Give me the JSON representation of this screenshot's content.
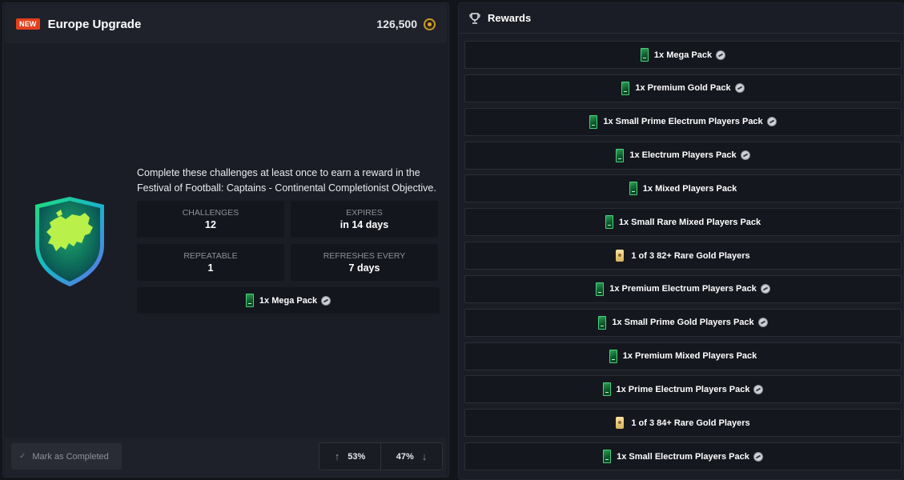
{
  "header": {
    "badge": "NEW",
    "title": "Europe Upgrade",
    "price": "126,500"
  },
  "description": "Complete these challenges at least once to earn a reward in the Festival of Football: Captains - Continental Completionist Objective.",
  "stats": {
    "challenges": {
      "label": "CHALLENGES",
      "value": "12"
    },
    "expires": {
      "label": "EXPIRES",
      "value": "in 14 days"
    },
    "repeatable": {
      "label": "REPEATABLE",
      "value": "1"
    },
    "refreshes": {
      "label": "REFRESHES EVERY",
      "value": "7 days"
    }
  },
  "main_reward": {
    "label": "1x Mega Pack",
    "icon": "pack-icon",
    "untradeable": true
  },
  "footer": {
    "mark_completed": "Mark as Completed",
    "upvote_percent": "53%",
    "downvote_percent": "47%"
  },
  "rewards_panel": {
    "title": "Rewards",
    "items": [
      {
        "label": "1x Mega Pack",
        "icon": "pack-icon",
        "untradeable": true
      },
      {
        "label": "1x Premium Gold Pack",
        "icon": "pack-icon",
        "untradeable": true
      },
      {
        "label": "1x Small Prime Electrum Players Pack",
        "icon": "pack-icon",
        "untradeable": true
      },
      {
        "label": "1x Electrum Players Pack",
        "icon": "pack-icon",
        "untradeable": true
      },
      {
        "label": "1x Mixed Players Pack",
        "icon": "pack-icon",
        "untradeable": false
      },
      {
        "label": "1x Small Rare Mixed Players Pack",
        "icon": "pack-icon",
        "untradeable": false
      },
      {
        "label": "1 of 3 82+ Rare Gold Players",
        "icon": "player-icon",
        "untradeable": false
      },
      {
        "label": "1x Premium Electrum Players Pack",
        "icon": "pack-icon",
        "untradeable": true
      },
      {
        "label": "1x Small Prime Gold Players Pack",
        "icon": "pack-icon",
        "untradeable": true
      },
      {
        "label": "1x Premium Mixed Players Pack",
        "icon": "pack-icon",
        "untradeable": false
      },
      {
        "label": "1x Prime Electrum Players Pack",
        "icon": "pack-icon",
        "untradeable": true
      },
      {
        "label": "1 of 3 84+ Rare Gold Players",
        "icon": "player-icon",
        "untradeable": false
      },
      {
        "label": "1x Small Electrum Players Pack",
        "icon": "pack-icon",
        "untradeable": true
      }
    ]
  },
  "colors": {
    "accent_new": "#e2401c",
    "panel_bg": "#1b1d26",
    "pack_green": "#2c9e53",
    "coin_gold": "#c99a2a"
  }
}
